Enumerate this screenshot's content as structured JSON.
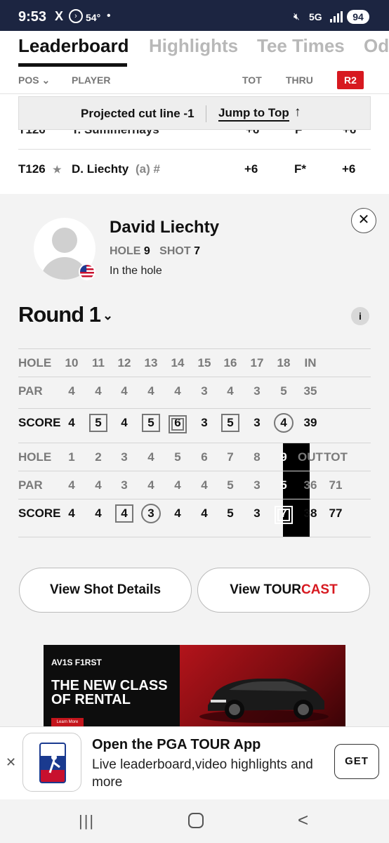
{
  "status_bar": {
    "time": "9:53",
    "temp": "54°",
    "network": "5G",
    "battery": "94"
  },
  "tabs": [
    "Leaderboard",
    "Highlights",
    "Tee Times",
    "Od"
  ],
  "leaderboard_header": {
    "pos": "POS",
    "player": "PLAYER",
    "tot": "TOT",
    "thru": "THRU",
    "round_badge": "R2"
  },
  "cut_banner": {
    "text": "Projected cut line -1",
    "jump_label": "Jump to Top",
    "jump_icon": "arrow-up-icon"
  },
  "partial_row": {
    "pos": "T126",
    "player": "T. Summerhays",
    "tot": "+6",
    "thru": "F",
    "rnd": "+6"
  },
  "player_row": {
    "pos": "T126",
    "name": "D. Liechty",
    "tag": "(a) #",
    "tot": "+6",
    "thru": "F*",
    "rnd": "+6"
  },
  "player_card": {
    "name": "David Liechty",
    "hole_label": "HOLE",
    "hole": "9",
    "shot_label": "SHOT",
    "shot": "7",
    "status": "In the hole",
    "close": "✕",
    "flag": "us-flag-icon"
  },
  "round": {
    "title": "Round 1",
    "chevron": "⌄",
    "info": "i"
  },
  "scorecard": {
    "back": {
      "holes": [
        "10",
        "11",
        "12",
        "13",
        "14",
        "15",
        "16",
        "17",
        "18"
      ],
      "hole_label": "HOLE",
      "in_label": "IN",
      "par_label": "PAR",
      "par": [
        "4",
        "4",
        "4",
        "4",
        "4",
        "3",
        "4",
        "3",
        "5"
      ],
      "par_total": "35",
      "score_label": "SCORE",
      "score": [
        "4",
        "5",
        "4",
        "5",
        "6",
        "3",
        "5",
        "3",
        "4"
      ],
      "score_marks": [
        "",
        "box",
        "",
        "box",
        "double-box",
        "",
        "box",
        "",
        "circle"
      ],
      "score_total": "39"
    },
    "front": {
      "holes": [
        "1",
        "2",
        "3",
        "4",
        "5",
        "6",
        "7",
        "8",
        "9"
      ],
      "hole_label": "HOLE",
      "out_label": "OUT",
      "tot_label": "TOT",
      "par_label": "PAR",
      "par": [
        "4",
        "4",
        "3",
        "4",
        "4",
        "4",
        "5",
        "3",
        "5"
      ],
      "par_out": "36",
      "par_tot": "71",
      "score_label": "SCORE",
      "score": [
        "4",
        "4",
        "4",
        "3",
        "4",
        "4",
        "5",
        "3",
        "7"
      ],
      "score_marks": [
        "",
        "",
        "box",
        "circle",
        "",
        "",
        "",
        "",
        "double-box"
      ],
      "score_out": "38",
      "score_tot": "77",
      "current_hole": "9"
    }
  },
  "buttons": {
    "shot_details": "View Shot Details",
    "tourcast_prefix": "View ",
    "tourcast_tour": "TOUR",
    "tourcast_cast": "CAST"
  },
  "ad": {
    "brand": "AV1S F1RST",
    "headline_1": "THE NEW CLASS",
    "headline_2": "OF RENTAL",
    "cta": "Learn More"
  },
  "app_banner": {
    "close": "✕",
    "title": "Open the PGA TOUR App",
    "subtitle": "Live leaderboard,video highlights and more",
    "get": "GET",
    "logo": "pga-tour-logo"
  },
  "nav": {
    "recent": "|||",
    "back": "<"
  }
}
